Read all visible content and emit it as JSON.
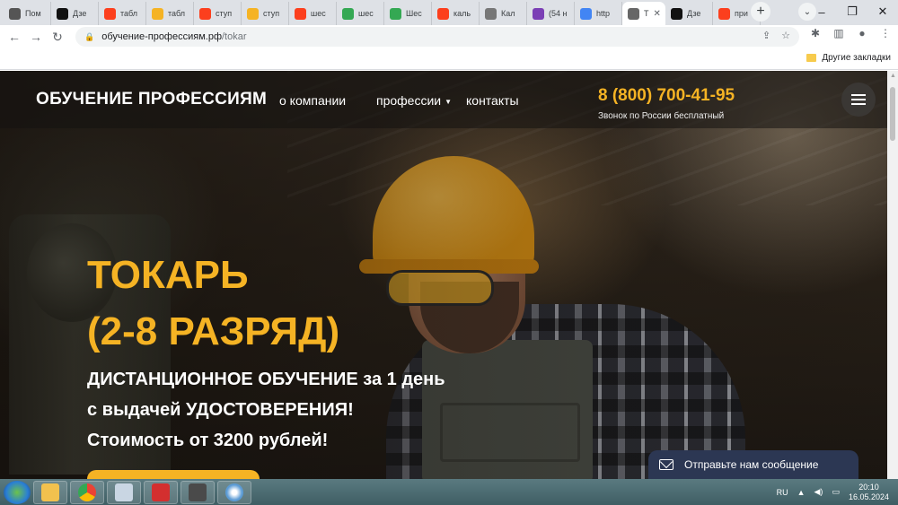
{
  "browser": {
    "tabs": [
      {
        "label": "Пом",
        "icon": "truck-icon",
        "color": "#555555"
      },
      {
        "label": "Дзе",
        "icon": "dzen-icon",
        "color": "#111111"
      },
      {
        "label": "табл",
        "icon": "yandex-icon",
        "color": "#fc3f1d"
      },
      {
        "label": "табл",
        "icon": "image-icon",
        "color": "#f5b324"
      },
      {
        "label": "ступ",
        "icon": "yandex-icon",
        "color": "#fc3f1d"
      },
      {
        "label": "ступ",
        "icon": "image-icon",
        "color": "#f5b324"
      },
      {
        "label": "шес",
        "icon": "yandex-icon",
        "color": "#fc3f1d"
      },
      {
        "label": "шес",
        "icon": "dots-icon",
        "color": "#34a853"
      },
      {
        "label": "Шес",
        "icon": "dots-icon",
        "color": "#34a853"
      },
      {
        "label": "каль",
        "icon": "yandex-icon",
        "color": "#fc3f1d"
      },
      {
        "label": "Кал",
        "icon": "calculator-icon",
        "color": "#777777"
      },
      {
        "label": "(54 н",
        "icon": "mail-icon",
        "color": "#7b3fb5"
      },
      {
        "label": "http",
        "icon": "google-icon",
        "color": "#4285f4"
      },
      {
        "label": "Т",
        "icon": "page-icon",
        "color": "#666666",
        "active": true
      },
      {
        "label": "Дзе",
        "icon": "dzen-icon",
        "color": "#111111"
      },
      {
        "label": "при",
        "icon": "yandex-icon",
        "color": "#fc3f1d"
      }
    ],
    "url_host": "обучение-профессиям.рф",
    "url_path": "/tokar",
    "bookmark_folder": "Другие закладки"
  },
  "site": {
    "logo": "ОБУЧЕНИЕ ПРОФЕССИЯМ",
    "nav": {
      "about": "о компании",
      "professions": "профессии",
      "contacts": "контакты"
    },
    "phone": "8 (800) 700-41-95",
    "phone_note": "Звонок по России бесплатный",
    "hero": {
      "title_line1": "ТОКАРЬ",
      "title_line2": "(2-8 РАЗРЯД)",
      "sub_line1": "ДИСТАНЦИОННОЕ ОБУЧЕНИЕ за 1 день",
      "sub_line2": "с выдачей УДОСТОВЕРЕНИЯ!",
      "sub_line3": "Стоимость от 3200 рублей!"
    },
    "chat_widget": "Отправьте нам сообщение",
    "accent_color": "#f5b324"
  },
  "taskbar": {
    "language": "RU",
    "time": "20:10",
    "date": "16.05.2024"
  }
}
